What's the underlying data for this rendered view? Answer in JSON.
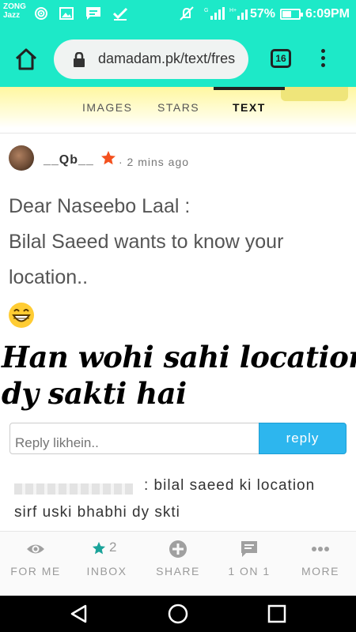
{
  "status_bar": {
    "carrier_line1": "ZONG",
    "carrier_line2": "Jazz",
    "battery": "57%",
    "battery_level": 0.57,
    "time": "6:09PM",
    "icons": [
      "hotspot-icon",
      "gallery-icon",
      "message-icon",
      "check-icon",
      "mute-icon",
      "signal-icon",
      "battery-icon"
    ]
  },
  "browser": {
    "url": "damadam.pk/text/fres",
    "tab_count": "16",
    "icons": [
      "home-icon",
      "lock-icon",
      "menu-icon"
    ]
  },
  "tabs": [
    {
      "label": "IMAGES"
    },
    {
      "label": "STARS"
    },
    {
      "label": "TEXT",
      "active": true
    }
  ],
  "post": {
    "username": "__Qb__",
    "timestamp": "· 2 mins ago",
    "lines": [
      "Dear Naseebo Laal :",
      "Bilal Saeed wants to know your",
      "location.."
    ],
    "emoji": "grinning-face-icon",
    "star_color": "#f4511e"
  },
  "overlay": {
    "line1": "Han wohi sahi location",
    "line2": "dy sakti hai"
  },
  "reply": {
    "placeholder": "Reply likhein..",
    "button_label": "reply",
    "accent": "#2db6ee"
  },
  "comment": {
    "line1": ": bilal saeed ki location",
    "line2": "sirf uski bhabhi dy skti"
  },
  "bottom_nav": [
    {
      "label": "FOR ME",
      "icon": "eye-icon"
    },
    {
      "label": "INBOX",
      "icon": "star-icon",
      "count": "2"
    },
    {
      "label": "SHARE",
      "icon": "plus-circle-icon"
    },
    {
      "label": "1 ON 1",
      "icon": "chat-icon"
    },
    {
      "label": "MORE",
      "icon": "more-dots-icon"
    }
  ],
  "theme": {
    "header_color": "#1de9c8",
    "tab_strip_color": "#fff7a0"
  }
}
